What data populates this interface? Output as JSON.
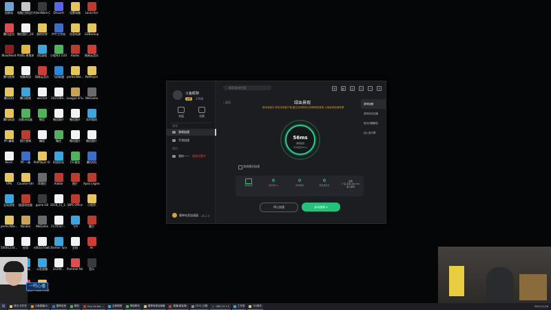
{
  "desktop": {
    "icons": [
      {
        "label": "回收站",
        "color": "#6aa5d8"
      },
      {
        "label": "电脑已经运行",
        "color": "#c5c5c5"
      },
      {
        "label": "AlienWare Control",
        "color": "#3a3a3a"
      },
      {
        "label": "Discord",
        "color": "#5865f2"
      },
      {
        "label": "设置电脑",
        "color": "#e6c65a"
      },
      {
        "label": "Launcher",
        "color": "#c0392b"
      },
      {
        "label": "腾讯会员",
        "color": "#e04b4b"
      },
      {
        "label": "微信图片_2021101...",
        "color": "#f2f2f2"
      },
      {
        "label": "我的世界",
        "color": "#e6c65a"
      },
      {
        "label": "中午工作站",
        "color": "#3a6ec8"
      },
      {
        "label": "信息电源",
        "color": "#e6c65a"
      },
      {
        "label": "G2Backup",
        "color": "#e6c65a"
      },
      {
        "label": "BloodHunt",
        "color": "#8b1e1e"
      },
      {
        "label": "PUBG 绝地求生",
        "color": "#e0b640"
      },
      {
        "label": "QQ游戏",
        "color": "#3aa6e0"
      },
      {
        "label": "小程序2 (101...)",
        "color": "#4fb35a"
      },
      {
        "label": "Hades",
        "color": "#c0392b"
      },
      {
        "label": "网易云音乐",
        "color": "#d33a31"
      },
      {
        "label": "腾讯视频",
        "color": "#e6c65a"
      },
      {
        "label": "电脑常用",
        "color": "#f2f2f2"
      },
      {
        "label": "网易云音乐",
        "color": "#d33a31"
      },
      {
        "label": "飞机联盟",
        "color": "#2a88d8"
      },
      {
        "label": "perfectWo...",
        "color": "#e6c65a"
      },
      {
        "label": "PotPlayer",
        "color": "#e6c65a"
      },
      {
        "label": "腾讯QQ",
        "color": "#e6c65a"
      },
      {
        "label": "腾讯视频",
        "color": "#3aa6e0"
      },
      {
        "label": "wechat",
        "color": "#f2f2f2"
      },
      {
        "label": "2021060...",
        "color": "#f2f2f2"
      },
      {
        "label": "League of Legends",
        "color": "#c9a34f"
      },
      {
        "label": "WeGame",
        "color": "#6a6a6a"
      },
      {
        "label": "腾讯网游",
        "color": "#e6c65a"
      },
      {
        "label": "谷歌浏览器",
        "color": "#4fb35a"
      },
      {
        "label": "微信",
        "color": "#4fb35a"
      },
      {
        "label": "微信图片",
        "color": "#f2f2f2"
      },
      {
        "label": "微信图片",
        "color": "#f2f2f2"
      },
      {
        "label": "实时相机",
        "color": "#3aa6e0"
      },
      {
        "label": "PR 编辑",
        "color": "#e6c65a"
      },
      {
        "label": "照片视频",
        "color": "#c0392b"
      },
      {
        "label": "编程",
        "color": "#f2f2f2"
      },
      {
        "label": "微信",
        "color": "#4fb35a"
      },
      {
        "label": "微信图片",
        "color": "#f2f2f2"
      },
      {
        "label": "微信图片",
        "color": "#f2f2f2"
      },
      {
        "label": "Kevin",
        "color": "#f2f2f2"
      },
      {
        "label": "PR 一级",
        "color": "#3a6ec8"
      },
      {
        "label": "PotPlayer 64 bit",
        "color": "#e6c65a"
      },
      {
        "label": "阿里旺旺",
        "color": "#3aa6e0"
      },
      {
        "label": "CS 服务",
        "color": "#4fb35a"
      },
      {
        "label": "腾讯QQ",
        "color": "#3a6ec8"
      },
      {
        "label": "VPN",
        "color": "#e6c65a"
      },
      {
        "label": "Counter-Strike: GO",
        "color": "#e6c65a"
      },
      {
        "label": "3D图片",
        "color": "#6a6a6a"
      },
      {
        "label": "Adobe",
        "color": "#c0392b"
      },
      {
        "label": "图片",
        "color": "#c0392b"
      },
      {
        "label": "Apex Legends",
        "color": "#c0392b"
      },
      {
        "label": "全局游戏",
        "color": "#3aa6e0"
      },
      {
        "label": "极速浏览器",
        "color": "#c0392b"
      },
      {
        "label": "game kill",
        "color": "#3a3a3a"
      },
      {
        "label": "2019_11_1...",
        "color": "#f2f2f2"
      },
      {
        "label": "WPS Office",
        "color": "#c0392b"
      },
      {
        "label": "小程序",
        "color": "#e6c65a"
      },
      {
        "label": "perfectWo...",
        "color": "#e6c65a"
      },
      {
        "label": "Naraka",
        "color": "#c9a34f"
      },
      {
        "label": "WeGame",
        "color": "#6a6a6a"
      },
      {
        "label": "2170547...",
        "color": "#f2f2f2"
      },
      {
        "label": "飞书",
        "color": "#3aa6e0"
      },
      {
        "label": "魔方",
        "color": "#c0392b"
      },
      {
        "label": "50001234...",
        "color": "#f2f2f2"
      },
      {
        "label": "应用",
        "color": "#f2f2f2"
      },
      {
        "label": "e0b1b7da8...",
        "color": "#f2f2f2"
      },
      {
        "label": "Xtreme Tuner",
        "color": "#3aa6e0"
      },
      {
        "label": "文档",
        "color": "#f2f2f2"
      },
      {
        "label": "Ali",
        "color": "#d33a31"
      },
      {
        "label": "网易UU加速",
        "color": "#3a6ec8"
      },
      {
        "label": "PotPlay",
        "color": "#3aa6e0"
      },
      {
        "label": "斗鱼直播",
        "color": "#3aa6e0"
      },
      {
        "label": "2e294...",
        "color": "#f2f2f2"
      },
      {
        "label": "Pummel Party",
        "color": "#e04b4b"
      },
      {
        "label": "音乐",
        "color": "#3a3a3a"
      },
      {
        "label": "Samsung Dex",
        "color": "#3a6ec8"
      },
      {
        "label": "Muse Dash",
        "color": "#e04b4b"
      },
      {
        "label": "PICO PARK",
        "color": "#e6c65a"
      }
    ]
  },
  "app": {
    "user": {
      "name": "斗鱼昵称",
      "vip": "VIP",
      "coins": "176币"
    },
    "side_buttons": [
      "充值",
      "兑换"
    ],
    "section_game": "游戏",
    "section_mine": "我的",
    "menu": [
      {
        "label": "游戏加速",
        "active": true
      },
      {
        "label": "手游加速",
        "active": false
      },
      {
        "label": "我的一一",
        "extra": "限制设置中",
        "active": false
      }
    ],
    "search_placeholder": "搜索游戏/应用",
    "top_icons": [
      "☰",
      "◐",
      "◎",
      "◇",
      "—",
      "✕"
    ],
    "back_label": "返回",
    "game_title": "绿血景观",
    "warning_text": "游戏加速中,请勿关闭客户端,建议关闭其他占用网络的程序,以免影响加速效果",
    "latency_value": "56ms",
    "latency_label": "游戏延迟",
    "latency_sub": "平均延迟56ms",
    "checkbox_label": "游戏模式加速",
    "stats": [
      {
        "value": "",
        "label": "游戏延迟"
      },
      {
        "value": "0",
        "label": "丢包率(%)"
      },
      {
        "value": "0",
        "label": "本地网络"
      },
      {
        "value": "0",
        "label": "服务器延迟"
      }
    ],
    "region_label": "当前",
    "region_value": "广东-东莞-491733",
    "region_extra": "进入游戏",
    "stop_label": "停止加速",
    "start_label": "启动游戏",
    "right_panel": [
      "游戏加速",
      "游戏优化加速",
      "常见问题解答",
      "加入官方群"
    ],
    "app_name": "雷神电竞加速器",
    "version": "v6.2.4"
  },
  "overlay": {
    "streamer_name": "一鸣心播"
  },
  "taskbar": {
    "items": [
      "首页-文件夹",
      "斗鱼直播(4)",
      "雷神加速",
      "微信",
      "Turn All the ...",
      "企鹅视频",
      "微信聊天",
      "雷神电竞加速器",
      "直播(超高清)",
      "1011_已推",
      "OBS 27.1.3",
      "工作室",
      "QQ音乐"
    ],
    "tray_text": "2021/11/28"
  }
}
